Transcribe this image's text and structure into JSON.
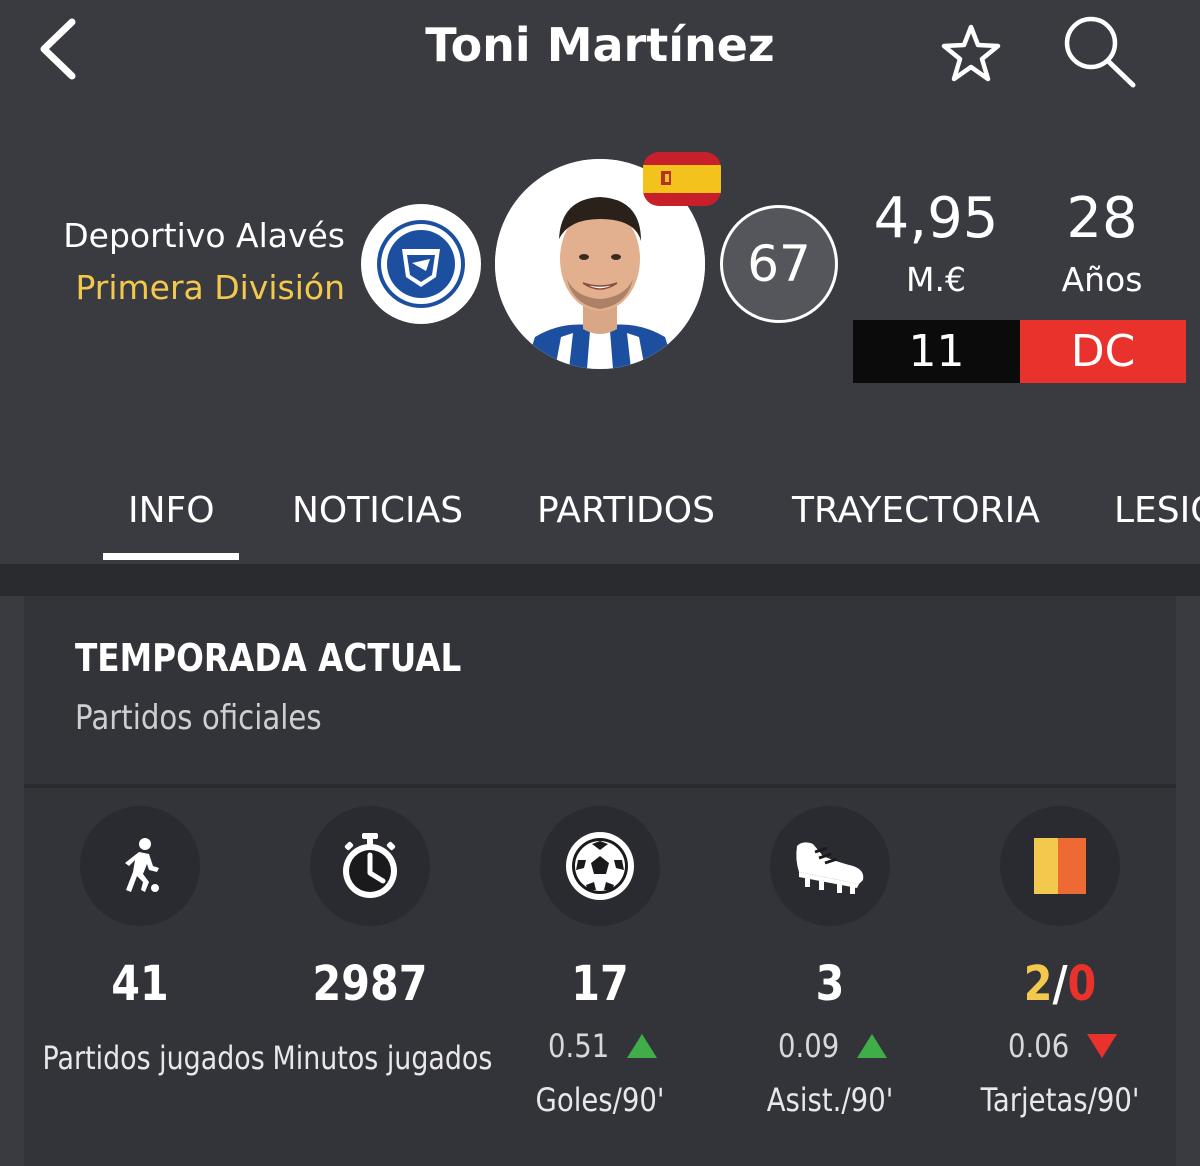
{
  "header": {
    "title": "Toni Martínez",
    "back_icon": "chevron-left-icon",
    "favorite_icon": "star-outline-icon",
    "search_icon": "search-icon"
  },
  "profile": {
    "club": "Deportivo Alavés",
    "league": "Primera División",
    "club_logo_icon": "alaves-crest-icon",
    "flag_icon": "spain-flag-icon",
    "rating": "67",
    "market_value": "4,95",
    "market_value_unit": "M.€",
    "age": "28",
    "age_unit": "Años",
    "shirt_number": "11",
    "position": "DC"
  },
  "tabs": [
    {
      "label": "INFO",
      "active": true
    },
    {
      "label": "NOTICIAS",
      "active": false
    },
    {
      "label": "PARTIDOS",
      "active": false
    },
    {
      "label": "TRAYECTORIA",
      "active": false
    },
    {
      "label": "LESIONES",
      "active": false
    }
  ],
  "season": {
    "title": "TEMPORADA ACTUAL",
    "subtitle": "Partidos oficiales",
    "stats": [
      {
        "icon": "player-running-icon",
        "value": "41",
        "label": "Partidos jugados"
      },
      {
        "icon": "stopwatch-icon",
        "value": "2987",
        "label": "Minutos jugados"
      },
      {
        "icon": "soccer-ball-icon",
        "value": "17",
        "rate": "0.51",
        "trend": "up",
        "label": "Goles/90'"
      },
      {
        "icon": "football-boot-icon",
        "value": "3",
        "rate": "0.09",
        "trend": "up",
        "label": "Asist./90'"
      },
      {
        "icon": "cards-icon",
        "value_yellow": "2",
        "value_sep": "/",
        "value_red": "0",
        "rate": "0.06",
        "trend": "down",
        "label": "Tarjetas/90'"
      }
    ]
  },
  "colors": {
    "background": "#3a3b40",
    "accent_yellow": "#f2c94c",
    "accent_red": "#e8322b",
    "trend_up": "#3fae49"
  }
}
